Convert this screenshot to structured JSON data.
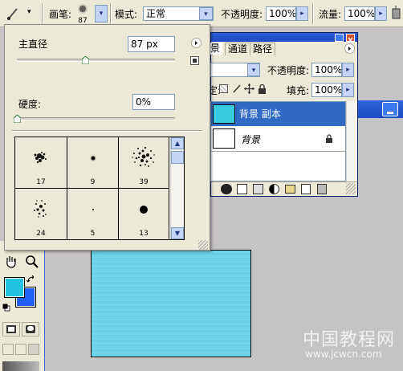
{
  "options_bar": {
    "brush_label": "画笔:",
    "brush_size_value": "87",
    "mode_label": "模式:",
    "mode_value": "正常",
    "opacity_label": "不透明度:",
    "opacity_value": "100%",
    "flow_label": "流量:",
    "flow_value": "100%"
  },
  "brush_popup": {
    "master_diameter_label": "主直径",
    "master_diameter_value": "87 px",
    "hardness_label": "硬度:",
    "hardness_value": "0%",
    "master_diameter_slider_level": 0.43,
    "hardness_slider_level": 0.0,
    "presets": [
      {
        "size": "17",
        "shape": "splatter-small"
      },
      {
        "size": "9",
        "shape": "dot-soft"
      },
      {
        "size": "39",
        "shape": "splatter-large"
      },
      {
        "size": "24",
        "shape": "splatter-medium"
      },
      {
        "size": "5",
        "shape": "dot-tiny"
      },
      {
        "size": "13",
        "shape": "dot-hard"
      }
    ]
  },
  "layers_panel": {
    "tabs": [
      "景",
      "通道",
      "路径"
    ],
    "blend_mode": "",
    "opacity_label": "不透明度:",
    "opacity_value": "100%",
    "lock_label": "定:",
    "fill_label": "填充:",
    "fill_value": "100%",
    "layers": [
      {
        "name": "背景 副本",
        "selected": true,
        "thumb_color": "#36cde3"
      },
      {
        "name": "背景",
        "selected": false,
        "thumb_color": "#ffffff",
        "locked": true
      }
    ]
  },
  "toolbox": {
    "foreground_color": "#22c2e0",
    "background_color": "#1e5ff5"
  },
  "document": {
    "canvas_color": "#6fd3e6"
  },
  "watermark": {
    "title": "中国教程网",
    "url": "www.jcwcn.com"
  }
}
